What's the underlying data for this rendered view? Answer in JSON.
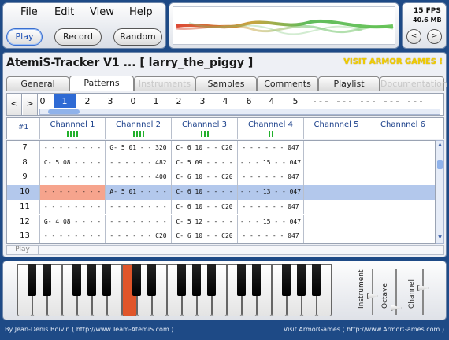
{
  "menu": {
    "file": "File",
    "edit": "Edit",
    "view": "View",
    "help": "Help"
  },
  "transport": {
    "play": "Play",
    "record": "Record",
    "random": "Random"
  },
  "stats": {
    "fps": "15 FPS",
    "memory": "40.6 MB",
    "prev": "<",
    "next": ">"
  },
  "title": "AtemiS-Tracker V1 ... [ larry_the_piggy ]",
  "promo": "VISIT ARMOR GAMES !",
  "tabs": [
    {
      "label": "General",
      "state": "normal"
    },
    {
      "label": "Patterns",
      "state": "active"
    },
    {
      "label": "Instruments",
      "state": "disabled"
    },
    {
      "label": "Samples",
      "state": "normal"
    },
    {
      "label": "Comments",
      "state": "normal"
    },
    {
      "label": "Playlist",
      "state": "normal"
    },
    {
      "label": "Documentation",
      "state": "disabled"
    }
  ],
  "order": {
    "prev": "<",
    "next": ">",
    "cells": [
      "0",
      "1",
      "2",
      "3",
      "0",
      "1",
      "2",
      "3",
      "4",
      "6",
      "4",
      "5",
      "- - -",
      "- - -",
      "- - -",
      "- - -",
      "- - -"
    ],
    "selected_index": 1
  },
  "grid": {
    "pattern_label": "#1",
    "channels": [
      "Channnel 1",
      "Channnel 2",
      "Channnel 3",
      "Channnel 4",
      "Channnel 5",
      "Channnel 6"
    ],
    "channel_meter_bars": [
      4,
      4,
      3,
      2,
      0,
      0
    ],
    "rows": [
      {
        "n": "7",
        "cells": [
          "- - - - - - - -",
          "G- 5 01 - - 320",
          "C- 6 10 - - C20",
          "- - - - - - 047",
          "",
          ""
        ]
      },
      {
        "n": "8",
        "cells": [
          "C- 5 08 - - - -",
          "- - - - - - 482",
          "C- 5 09 - - - -",
          "- - - 15 - - 047",
          "",
          ""
        ]
      },
      {
        "n": "9",
        "cells": [
          "- - - - - - - -",
          "- - - - - - 400",
          "C- 6 10 - - C20",
          "- - - - - - 047",
          "",
          ""
        ]
      },
      {
        "n": "10",
        "cells": [
          "- - - - - - - -",
          "A- 5 01 - - - -",
          "C- 6 10 - - - -",
          "- - - 13 - - 047",
          "",
          ""
        ]
      },
      {
        "n": "11",
        "cells": [
          "- - - - - - - -",
          "- - - - - - - -",
          "C- 6 10 - - C20",
          "- - - - - - 047",
          "",
          ""
        ]
      },
      {
        "n": "12",
        "cells": [
          "G- 4 08 - - - -",
          "- - - - - - - -",
          "C- 5 12 - - - -",
          "- - - 15 - - 047",
          "",
          ""
        ]
      },
      {
        "n": "13",
        "cells": [
          "- - - - - - - -",
          "- - - - - - C20",
          "C- 6 10 - - C20",
          "- - - - - - 047",
          "",
          ""
        ]
      }
    ],
    "selected_row": 3,
    "play_label": "Play"
  },
  "piano": {
    "active_key": "white-7",
    "sliders": [
      "Instrument",
      "Octave",
      "Channel"
    ]
  },
  "footer": {
    "left": "By Jean-Denis Boivin ( http://www.Team-AtemiS.com )",
    "right": "Visit ArmorGames ( http://www.ArmorGames.com )"
  },
  "colors": {
    "accent": "#2e6ad4",
    "highlight": "#f6a48d",
    "selected_row": "#b3c8ec",
    "background": "#1e4a86",
    "meter": "#22b02c"
  }
}
